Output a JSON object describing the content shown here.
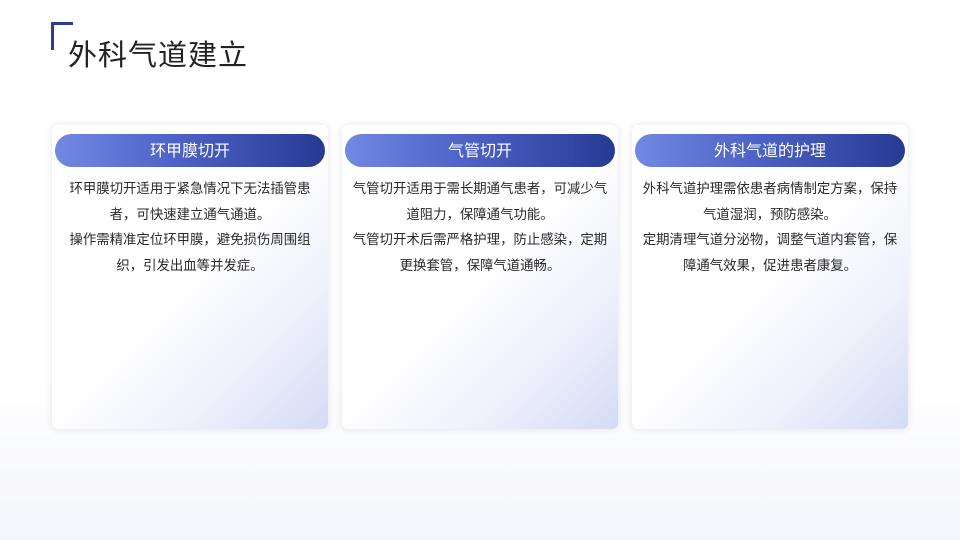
{
  "title": "外科气道建立",
  "cards": [
    {
      "heading": "环甲膜切开",
      "paragraphs": [
        "环甲膜切开适用于紧急情况下无法插管患者，可快速建立通气通道。",
        "操作需精准定位环甲膜，避免损伤周围组织，引发出血等并发症。"
      ]
    },
    {
      "heading": "气管切开",
      "paragraphs": [
        "气管切开适用于需长期通气患者，可减少气道阻力，保障通气功能。",
        "气管切开术后需严格护理，防止感染，定期更换套管，保障气道通畅。"
      ]
    },
    {
      "heading": "外科气道的护理",
      "paragraphs": [
        "外科气道护理需依患者病情制定方案，保持气道湿润，预防感染。",
        "定期清理气道分泌物，调整气道内套管，保障通气效果，促进患者康复。"
      ]
    }
  ],
  "colors": {
    "accent_dark": "#273a93",
    "accent_light": "#7289e2",
    "bracket": "#2e3d8f",
    "text": "#2a2a2a"
  }
}
